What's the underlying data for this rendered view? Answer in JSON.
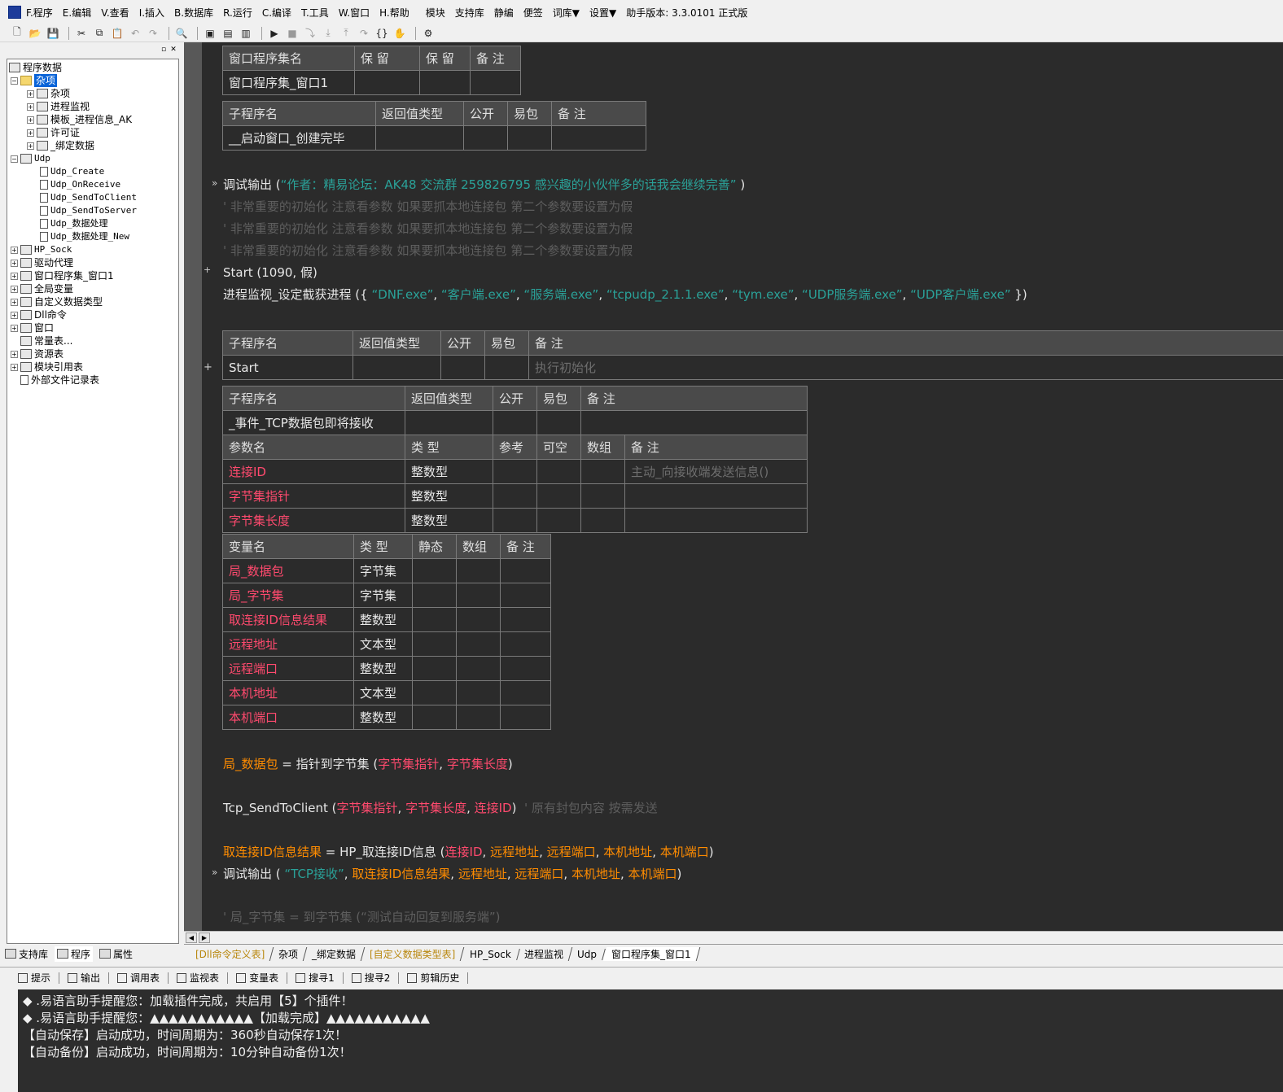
{
  "menubar": {
    "items": [
      "F.程序",
      "E.编辑",
      "V.查看",
      "I.插入",
      "B.数据库",
      "R.运行",
      "C.编译",
      "T.工具",
      "W.窗口",
      "H.帮助",
      "模块",
      "支持库",
      "静编",
      "便签",
      "词库▼",
      "设置▼"
    ],
    "version": "助手版本: 3.3.0101 正式版"
  },
  "toolbar": {
    "icons": [
      "new-icon",
      "open-icon",
      "save-icon",
      "cut-icon",
      "copy-icon",
      "paste-icon",
      "undo-icon",
      "redo-icon",
      "find-icon",
      "layout1-icon",
      "layout2-icon",
      "layout3-icon",
      "run-icon",
      "stop-icon",
      "step-icon",
      "step-in-icon",
      "step-out-icon",
      "step-over-icon",
      "breakpoint-icon",
      "hand-icon",
      "wizard-icon"
    ]
  },
  "tree": {
    "root": "程序数据",
    "items": [
      {
        "label": "杂项",
        "selected": true
      },
      {
        "label": "杂项"
      },
      {
        "label": "进程监视"
      },
      {
        "label": "模板_进程信息_AK"
      },
      {
        "label": "许可证"
      },
      {
        "label": "_绑定数据"
      },
      {
        "label": "Udp"
      },
      {
        "label": "Udp_Create"
      },
      {
        "label": "Udp_OnReceive"
      },
      {
        "label": "Udp_SendToClient"
      },
      {
        "label": "Udp_SendToServer"
      },
      {
        "label": "Udp_数据处理"
      },
      {
        "label": "Udp_数据处理_New"
      },
      {
        "label": "HP_Sock"
      },
      {
        "label": "驱动代理"
      },
      {
        "label": "窗口程序集_窗口1"
      },
      {
        "label": "全局变量"
      },
      {
        "label": "自定义数据类型"
      },
      {
        "label": "Dll命令"
      },
      {
        "label": "窗口"
      },
      {
        "label": "常量表..."
      },
      {
        "label": "资源表"
      },
      {
        "label": "模块引用表"
      },
      {
        "label": "外部文件记录表"
      }
    ]
  },
  "left_tabs": [
    "支持库",
    "程序",
    "属性"
  ],
  "editor": {
    "assembly_table": {
      "headers": [
        "窗口程序集名",
        "保 留",
        "保 留",
        "备 注"
      ],
      "row": [
        "窗口程序集_窗口1",
        "",
        "",
        ""
      ]
    },
    "sub1_table": {
      "headers": [
        "子程序名",
        "返回值类型",
        "公开",
        "易包",
        "备 注"
      ],
      "row": [
        "__启动窗口_创建完毕",
        "",
        "",
        "",
        ""
      ]
    },
    "line1": {
      "fn": "调试输出 (",
      "str": "“作者：精易论坛：AK48  交流群 259826795 感兴趣的小伙伴多的话我会继续完善”",
      "end": ")"
    },
    "comment1": "' 非常重要的初始化 注意看参数 如果要抓本地连接包 第二个参数要设置为假",
    "comment2": "' 非常重要的初始化 注意看参数 如果要抓本地连接包 第二个参数要设置为假",
    "comment3": "' 非常重要的初始化 注意看参数 如果要抓本地连接包 第二个参数要设置为假",
    "start_line": "Start (1090, 假)",
    "monitor_fn": "进程监视_设定截获进程 ({",
    "monitor_args": [
      "“DNF.exe”",
      "“客户端.exe”",
      "“服务端.exe”",
      "“tcpudp_2.1.1.exe”",
      "“tym.exe”",
      "“UDP服务端.exe”",
      "“UDP客户端.exe”"
    ],
    "monitor_end": "})",
    "sub2_table": {
      "headers": [
        "子程序名",
        "返回值类型",
        "公开",
        "易包",
        "备 注"
      ],
      "row": [
        "Start",
        "",
        "",
        "",
        "执行初始化"
      ]
    },
    "sub3_table": {
      "headers": [
        "子程序名",
        "返回值类型",
        "公开",
        "易包",
        "备 注"
      ],
      "row": [
        "_事件_TCP数据包即将接收",
        "",
        "",
        "",
        ""
      ],
      "param_headers": [
        "参数名",
        "类 型",
        "参考",
        "可空",
        "数组",
        "备 注"
      ],
      "params": [
        [
          "连接ID",
          "整数型",
          "",
          "",
          "",
          "主动_向接收端发送信息()"
        ],
        [
          "字节集指针",
          "整数型",
          "",
          "",
          "",
          ""
        ],
        [
          "字节集长度",
          "整数型",
          "",
          "",
          "",
          ""
        ]
      ]
    },
    "var_table": {
      "headers": [
        "变量名",
        "类 型",
        "静态",
        "数组",
        "备 注"
      ],
      "rows": [
        [
          "局_数据包",
          "字节集"
        ],
        [
          "局_字节集",
          "字节集"
        ],
        [
          "取连接ID信息结果",
          "整数型"
        ],
        [
          "远程地址",
          "文本型"
        ],
        [
          "远程端口",
          "整数型"
        ],
        [
          "本机地址",
          "文本型"
        ],
        [
          "本机端口",
          "整数型"
        ]
      ]
    },
    "code_a": {
      "lhs": "局_数据包",
      "op": " = ",
      "fn": "指针到字节集 (",
      "a1": "字节集指针",
      "sep": ", ",
      "a2": "字节集长度",
      "end": ")"
    },
    "code_b": {
      "fn": "Tcp_SendToClient (",
      "a1": "字节集指针",
      "sep1": ", ",
      "a2": "字节集长度",
      "sep2": ", ",
      "a3": "连接ID",
      "end": ")",
      "cmt": "' 原有封包内容 按需发送"
    },
    "code_c": {
      "lhs": "取连接ID信息结果",
      "op": " = ",
      "fn": "HP_取连接ID信息 (",
      "a1": "连接ID",
      "a2": "远程地址",
      "a3": "远程端口",
      "a4": "本机地址",
      "a5": "本机端口",
      "end": ")"
    },
    "code_d": {
      "fn": "调试输出 (",
      "str": "“TCP接收”",
      "a1": "取连接ID信息结果",
      "a2": "远程地址",
      "a3": "远程端口",
      "a4": "本机地址",
      "a5": "本机端口",
      "end": ")"
    },
    "code_e": "' 局_字节集 = 到字节集 (“测试自动回复到服务端”)"
  },
  "doc_tabs": [
    "[Dll命令定义表]",
    "杂项",
    "_绑定数据",
    "[自定义数据类型表]",
    "HP_Sock",
    "进程监视",
    "Udp",
    "窗口程序集_窗口1"
  ],
  "bottom_tabs": [
    "提示",
    "输出",
    "调用表",
    "监视表",
    "变量表",
    "搜寻1",
    "搜寻2",
    "剪辑历史"
  ],
  "output_lines": [
    "◆ .易语言助手提醒您：加载插件完成，共启用【5】个插件！",
    "◆ .易语言助手提醒您：▲▲▲▲▲▲▲▲▲▲▲【加载完成】▲▲▲▲▲▲▲▲▲▲▲",
    "【自动保存】启动成功，时间周期为：360秒自动保存1次！",
    "【自动备份】启动成功，时间周期为：10分钟自动备份1次！"
  ]
}
